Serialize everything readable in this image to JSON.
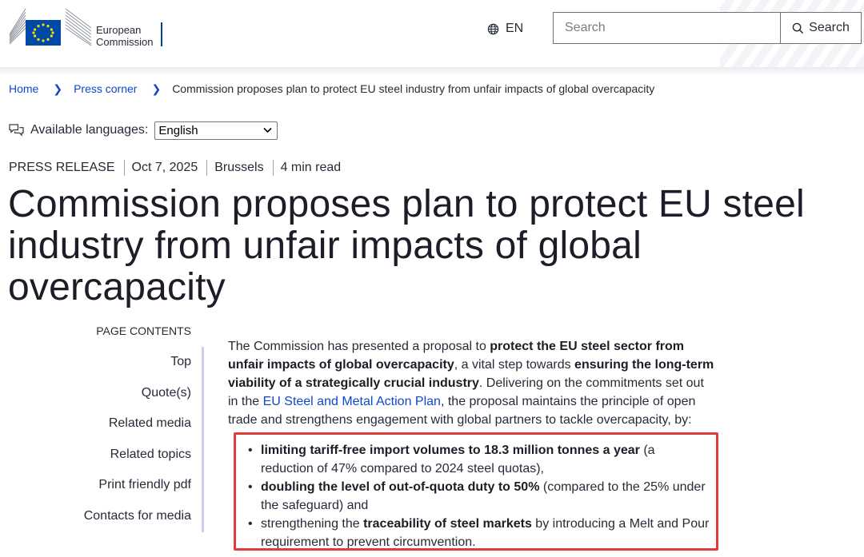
{
  "header": {
    "logo_line1": "European",
    "logo_line2": "Commission",
    "language_code": "EN",
    "search_placeholder": "Search",
    "search_button": "Search",
    "brand_color": "#004494",
    "eu_flag_color": "#0049a6",
    "eu_star_color": "#ffdd00"
  },
  "breadcrumb": {
    "items": [
      "Home",
      "Press corner"
    ],
    "current": "Commission proposes plan to protect EU steel industry from unfair impacts of global overcapacity"
  },
  "languages": {
    "label": "Available languages:",
    "selected": "English"
  },
  "meta": {
    "type": "PRESS RELEASE",
    "date": "Oct 7, 2025",
    "place": "Brussels",
    "read_time": "4 min read"
  },
  "title": "Commission proposes plan to protect EU steel industry from unfair impacts of global overcapacity",
  "page_contents": {
    "heading": "PAGE CONTENTS",
    "items": [
      "Top",
      "Quote(s)",
      "Related media",
      "Related topics",
      "Print friendly pdf",
      "Contacts for media"
    ]
  },
  "intro": {
    "t1": "The Commission has presented a proposal to ",
    "b1": "protect the EU steel sector from unfair impacts of global overcapacity",
    "t2": ", a vital step towards ",
    "b2": "ensuring the long-term viability of a strategically crucial industry",
    "t3": ". Delivering on the commitments set out in the ",
    "link": "EU Steel and Metal Action Plan",
    "t4": ", the proposal maintains the principle of open trade and strengthens engagement with global partners to tackle overcapacity, by:"
  },
  "bullets": [
    {
      "pre": "",
      "bold": "limiting tariff-free import volumes to 18.3 million tonnes a year",
      "post": " (a reduction of 47% compared to 2024 steel quotas),"
    },
    {
      "pre": "",
      "bold": "doubling the level of out-of-quota duty to 50%",
      "post": " (compared to the 25% under the safeguard) and"
    },
    {
      "pre": "strengthening the ",
      "bold": "traceability of steel markets",
      "post": " by introducing a Melt and Pour requirement to prevent circumvention."
    }
  ],
  "colors": {
    "link": "#0e47cb",
    "highlight_border": "#e23b3b",
    "toc_bar": "#c8ceeb"
  }
}
